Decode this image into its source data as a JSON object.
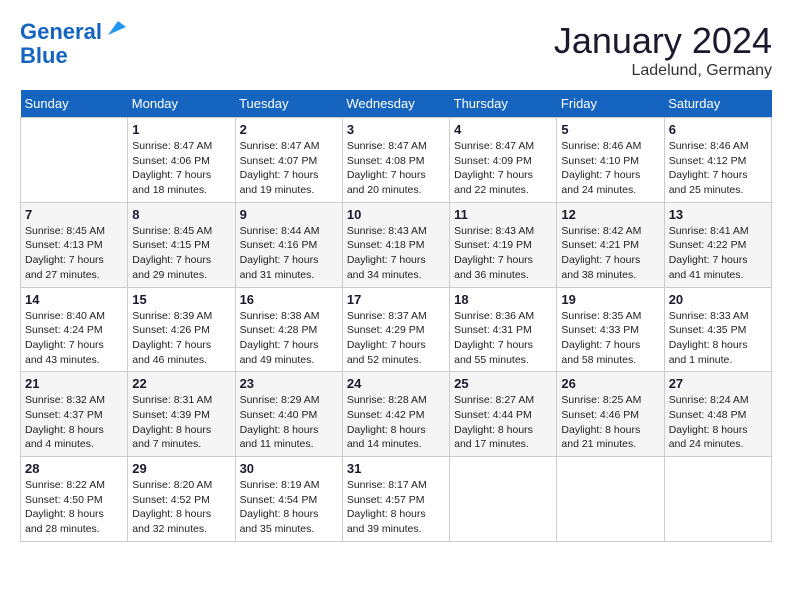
{
  "header": {
    "logo_line1": "General",
    "logo_line2": "Blue",
    "month_title": "January 2024",
    "location": "Ladelund, Germany"
  },
  "days_of_week": [
    "Sunday",
    "Monday",
    "Tuesday",
    "Wednesday",
    "Thursday",
    "Friday",
    "Saturday"
  ],
  "weeks": [
    [
      {
        "day": "",
        "info": ""
      },
      {
        "day": "1",
        "info": "Sunrise: 8:47 AM\nSunset: 4:06 PM\nDaylight: 7 hours\nand 18 minutes."
      },
      {
        "day": "2",
        "info": "Sunrise: 8:47 AM\nSunset: 4:07 PM\nDaylight: 7 hours\nand 19 minutes."
      },
      {
        "day": "3",
        "info": "Sunrise: 8:47 AM\nSunset: 4:08 PM\nDaylight: 7 hours\nand 20 minutes."
      },
      {
        "day": "4",
        "info": "Sunrise: 8:47 AM\nSunset: 4:09 PM\nDaylight: 7 hours\nand 22 minutes."
      },
      {
        "day": "5",
        "info": "Sunrise: 8:46 AM\nSunset: 4:10 PM\nDaylight: 7 hours\nand 24 minutes."
      },
      {
        "day": "6",
        "info": "Sunrise: 8:46 AM\nSunset: 4:12 PM\nDaylight: 7 hours\nand 25 minutes."
      }
    ],
    [
      {
        "day": "7",
        "info": "Sunrise: 8:45 AM\nSunset: 4:13 PM\nDaylight: 7 hours\nand 27 minutes."
      },
      {
        "day": "8",
        "info": "Sunrise: 8:45 AM\nSunset: 4:15 PM\nDaylight: 7 hours\nand 29 minutes."
      },
      {
        "day": "9",
        "info": "Sunrise: 8:44 AM\nSunset: 4:16 PM\nDaylight: 7 hours\nand 31 minutes."
      },
      {
        "day": "10",
        "info": "Sunrise: 8:43 AM\nSunset: 4:18 PM\nDaylight: 7 hours\nand 34 minutes."
      },
      {
        "day": "11",
        "info": "Sunrise: 8:43 AM\nSunset: 4:19 PM\nDaylight: 7 hours\nand 36 minutes."
      },
      {
        "day": "12",
        "info": "Sunrise: 8:42 AM\nSunset: 4:21 PM\nDaylight: 7 hours\nand 38 minutes."
      },
      {
        "day": "13",
        "info": "Sunrise: 8:41 AM\nSunset: 4:22 PM\nDaylight: 7 hours\nand 41 minutes."
      }
    ],
    [
      {
        "day": "14",
        "info": "Sunrise: 8:40 AM\nSunset: 4:24 PM\nDaylight: 7 hours\nand 43 minutes."
      },
      {
        "day": "15",
        "info": "Sunrise: 8:39 AM\nSunset: 4:26 PM\nDaylight: 7 hours\nand 46 minutes."
      },
      {
        "day": "16",
        "info": "Sunrise: 8:38 AM\nSunset: 4:28 PM\nDaylight: 7 hours\nand 49 minutes."
      },
      {
        "day": "17",
        "info": "Sunrise: 8:37 AM\nSunset: 4:29 PM\nDaylight: 7 hours\nand 52 minutes."
      },
      {
        "day": "18",
        "info": "Sunrise: 8:36 AM\nSunset: 4:31 PM\nDaylight: 7 hours\nand 55 minutes."
      },
      {
        "day": "19",
        "info": "Sunrise: 8:35 AM\nSunset: 4:33 PM\nDaylight: 7 hours\nand 58 minutes."
      },
      {
        "day": "20",
        "info": "Sunrise: 8:33 AM\nSunset: 4:35 PM\nDaylight: 8 hours\nand 1 minute."
      }
    ],
    [
      {
        "day": "21",
        "info": "Sunrise: 8:32 AM\nSunset: 4:37 PM\nDaylight: 8 hours\nand 4 minutes."
      },
      {
        "day": "22",
        "info": "Sunrise: 8:31 AM\nSunset: 4:39 PM\nDaylight: 8 hours\nand 7 minutes."
      },
      {
        "day": "23",
        "info": "Sunrise: 8:29 AM\nSunset: 4:40 PM\nDaylight: 8 hours\nand 11 minutes."
      },
      {
        "day": "24",
        "info": "Sunrise: 8:28 AM\nSunset: 4:42 PM\nDaylight: 8 hours\nand 14 minutes."
      },
      {
        "day": "25",
        "info": "Sunrise: 8:27 AM\nSunset: 4:44 PM\nDaylight: 8 hours\nand 17 minutes."
      },
      {
        "day": "26",
        "info": "Sunrise: 8:25 AM\nSunset: 4:46 PM\nDaylight: 8 hours\nand 21 minutes."
      },
      {
        "day": "27",
        "info": "Sunrise: 8:24 AM\nSunset: 4:48 PM\nDaylight: 8 hours\nand 24 minutes."
      }
    ],
    [
      {
        "day": "28",
        "info": "Sunrise: 8:22 AM\nSunset: 4:50 PM\nDaylight: 8 hours\nand 28 minutes."
      },
      {
        "day": "29",
        "info": "Sunrise: 8:20 AM\nSunset: 4:52 PM\nDaylight: 8 hours\nand 32 minutes."
      },
      {
        "day": "30",
        "info": "Sunrise: 8:19 AM\nSunset: 4:54 PM\nDaylight: 8 hours\nand 35 minutes."
      },
      {
        "day": "31",
        "info": "Sunrise: 8:17 AM\nSunset: 4:57 PM\nDaylight: 8 hours\nand 39 minutes."
      },
      {
        "day": "",
        "info": ""
      },
      {
        "day": "",
        "info": ""
      },
      {
        "day": "",
        "info": ""
      }
    ]
  ]
}
